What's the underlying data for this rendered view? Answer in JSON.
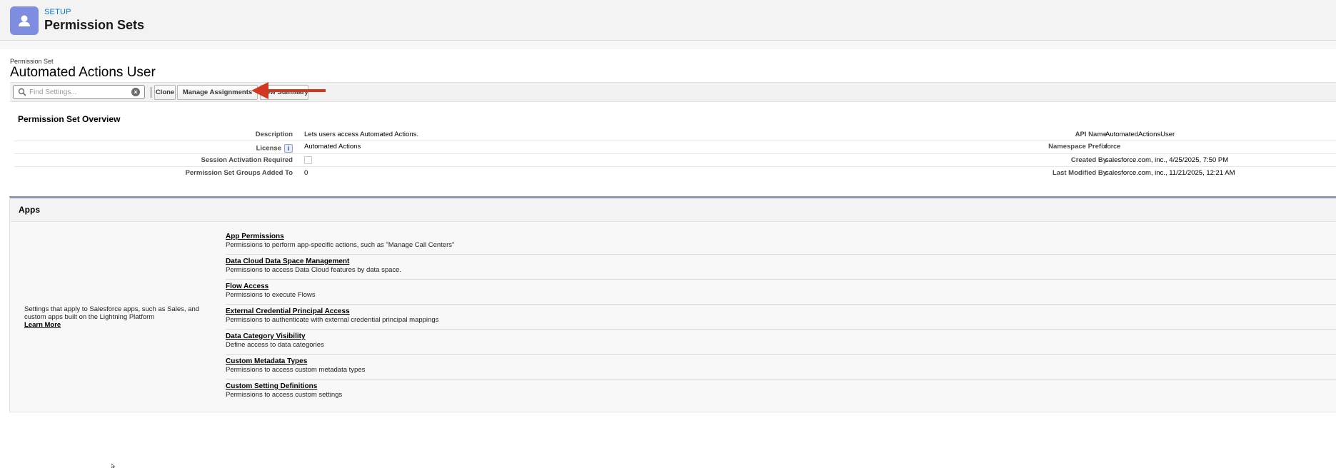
{
  "header": {
    "eyebrow": "SETUP",
    "title": "Permission Sets"
  },
  "permission_set": {
    "eyebrow": "Permission Set",
    "title": "Automated Actions User"
  },
  "toolbar": {
    "search_placeholder": "Find Settings...",
    "clone_label": "Clone",
    "manage_label": "Manage Assignments",
    "summary_label": "View Summary"
  },
  "overview": {
    "title": "Permission Set Overview",
    "left": [
      {
        "label": "Description",
        "value": "Lets users access Automated Actions."
      },
      {
        "label": "License",
        "value": "Automated Actions"
      },
      {
        "label": "Session Activation Required",
        "value": ""
      },
      {
        "label": "Permission Set Groups Added To",
        "value": "0"
      }
    ],
    "right": [
      {
        "label": "API Name",
        "value": "AutomatedActionsUser"
      },
      {
        "label": "Namespace Prefix",
        "value": "force"
      },
      {
        "label": "Created By",
        "value": "salesforce.com, inc., 4/25/2025, 7:50 PM"
      },
      {
        "label": "Last Modified By",
        "value": "salesforce.com, inc., 11/21/2025, 12:21 AM"
      }
    ]
  },
  "apps": {
    "title": "Apps",
    "description": "Settings that apply to Salesforce apps, such as Sales, and custom apps built on the Lightning Platform",
    "learn_more": "Learn More",
    "items": [
      {
        "title": "App Permissions",
        "subtitle": "Permissions to perform app-specific actions, such as \"Manage Call Centers\""
      },
      {
        "title": "Data Cloud Data Space Management",
        "subtitle": "Permissions to access Data Cloud features by data space."
      },
      {
        "title": "Flow Access",
        "subtitle": "Permissions to execute Flows"
      },
      {
        "title": "External Credential Principal Access",
        "subtitle": "Permissions to authenticate with external credential principal mappings"
      },
      {
        "title": "Data Category Visibility",
        "subtitle": "Define access to data categories"
      },
      {
        "title": "Custom Metadata Types",
        "subtitle": "Permissions to access custom metadata types"
      },
      {
        "title": "Custom Setting Definitions",
        "subtitle": "Permissions to access custom settings"
      }
    ]
  },
  "colors": {
    "accent_blue": "#0176d3",
    "setup_icon_bg": "#7f8de1",
    "annotation_arrow": "#d0391f"
  },
  "icons": {
    "setup": "user-icon",
    "search": "search-icon",
    "clear": "clear-icon",
    "license_info": "info-icon"
  }
}
